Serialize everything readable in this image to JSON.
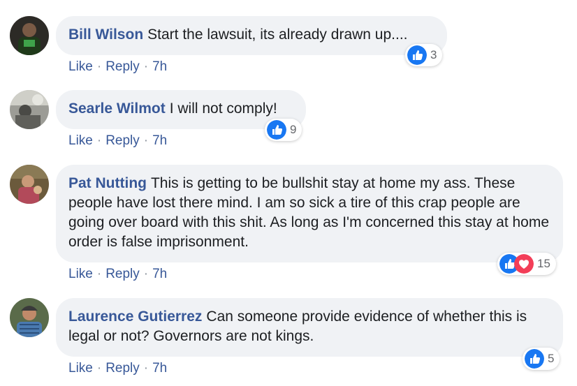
{
  "comments": [
    {
      "author": "Bill Wilson",
      "text": "Start the lawsuit, its already drawn up....",
      "reaction_count": "3",
      "reactions": [
        "like-icon"
      ],
      "actions": {
        "like": "Like",
        "reply": "Reply",
        "time": "7h"
      }
    },
    {
      "author": "Searle Wilmot",
      "text": "I will not comply!",
      "reaction_count": "9",
      "reactions": [
        "like-icon"
      ],
      "actions": {
        "like": "Like",
        "reply": "Reply",
        "time": "7h"
      }
    },
    {
      "author": "Pat Nutting",
      "text": "This is getting to be bullshit stay at home my ass. These people have lost there mind. I am so sick a tire of this crap people are going over board with this shit. As long as I'm concerned this stay at home order is false imprisonment.",
      "reaction_count": "15",
      "reactions": [
        "like-icon",
        "love-icon"
      ],
      "actions": {
        "like": "Like",
        "reply": "Reply",
        "time": "7h"
      }
    },
    {
      "author": "Laurence Gutierrez",
      "text": "Can someone provide evidence of whether this is legal or not? Governors are not kings.",
      "reaction_count": "5",
      "reactions": [
        "like-icon"
      ],
      "actions": {
        "like": "Like",
        "reply": "Reply",
        "time": "7h"
      }
    }
  ],
  "colors": {
    "author": "#385898",
    "bubble": "#f0f2f5",
    "like_blue": "#1877f2",
    "love_red": "#f33e58",
    "meta_gray": "#65676b"
  },
  "separator": "·"
}
